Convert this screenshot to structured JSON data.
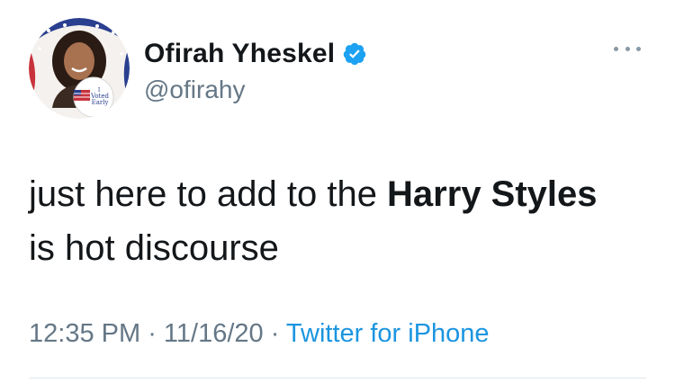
{
  "user": {
    "display_name": "Ofirah Yheskel",
    "handle": "@ofirahy",
    "verified": true,
    "avatar_badge_line1": "I",
    "avatar_badge_line2": "Voted",
    "avatar_badge_line3": "Early"
  },
  "tweet": {
    "text_part1": "just here to add to the ",
    "text_bold": "Harry Styles",
    "text_part2": " is hot discourse"
  },
  "meta": {
    "time": "12:35 PM",
    "separator1": " · ",
    "date": "11/16/20",
    "separator2": " · ",
    "source": "Twitter for iPhone"
  },
  "icons": {
    "verified": "verified-badge-icon",
    "more": "more-options-icon"
  },
  "colors": {
    "link": "#1b95e0",
    "secondary_text": "#657786",
    "verified_blue": "#1da1f2"
  }
}
